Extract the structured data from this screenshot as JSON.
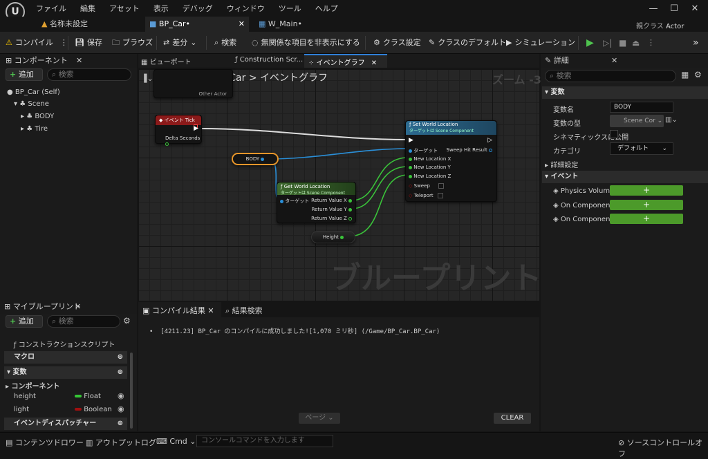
{
  "menu": [
    "ファイル",
    "編集",
    "アセット",
    "表示",
    "デバッグ",
    "ウィンドウ",
    "ツール",
    "ヘルプ"
  ],
  "tabs": {
    "untitled": "名称未設定",
    "bp_car": "BP_Car•",
    "w_main": "W_Main•"
  },
  "parent_class": {
    "label": "親クラス",
    "value": "Actor"
  },
  "toolbar": {
    "compile": "コンパイル",
    "save": "保存",
    "browse": "ブラウズ",
    "diff": "差分",
    "find": "検索",
    "hide_unrelated": "無関係な項目を非表示にする",
    "class_settings": "クラス設定",
    "class_defaults": "クラスのデフォルト",
    "simulation": "シミュレーション"
  },
  "components_panel": {
    "title": "コンポーネント",
    "add": "追加",
    "search_placeholder": "検索",
    "tree": [
      "BP_Car (Self)",
      "Scene",
      "BODY",
      "Tire"
    ]
  },
  "editor_tabs": {
    "viewport": "ビューポート",
    "construction": "Construction Scr...",
    "event_graph": "イベントグラフ"
  },
  "graph": {
    "breadcrumb_bp": "BP_Car",
    "breadcrumb_sep": ">",
    "breadcrumb_graph": "イベントグラフ",
    "zoom": "ズーム -3",
    "watermark": "ブループリント",
    "partial_node_pin": "Other Actor",
    "event_tick": {
      "title": "イベント Tick",
      "pin": "Delta Seconds"
    },
    "body_var": "BODY",
    "set_loc": {
      "title": "Set World Location",
      "subtitle": "ターゲットは Scene Component",
      "target": "ターゲット",
      "result": "Sweep Hit Result",
      "x": "New Location X",
      "y": "New Location Y",
      "z": "New Location Z",
      "sweep": "Sweep",
      "teleport": "Teleport"
    },
    "get_loc": {
      "title": "Get World Location",
      "subtitle": "ターゲットは Scene Component",
      "target": "ターゲット",
      "rx": "Return Value X",
      "ry": "Return Value Y",
      "rz": "Return Value Z"
    },
    "height_var": "Height"
  },
  "details": {
    "title": "詳細",
    "search_placeholder": "検索",
    "sec_variable": "変数",
    "var_name_label": "変数名",
    "var_name_value": "BODY",
    "var_type_label": "変数の型",
    "var_type_value": "Scene Cor",
    "cinematic_label": "シネマティックスに公開",
    "category_label": "カテゴリ",
    "category_value": "デフォルト",
    "advanced": "詳細設定",
    "sec_event": "イベント",
    "events": [
      "Physics Volume",
      "On Component",
      "On Component"
    ],
    "add_symbol": "+"
  },
  "my_blueprint": {
    "title": "マイブループリント",
    "add": "追加",
    "search_placeholder": "検索",
    "construction": "コンストラクションスクリプト",
    "macros": "マクロ",
    "variables": "変数",
    "components": "コンポーネント",
    "vars": [
      {
        "name": "height",
        "type": "Float",
        "color": "#35c635"
      },
      {
        "name": "light",
        "type": "Boolean",
        "color": "#a01010"
      }
    ],
    "dispatchers": "イベントディスパッチャー"
  },
  "compile_panel": {
    "tab_results": "コンパイル結果",
    "tab_find": "結果検索",
    "log": "[4211.23] BP_Car のコンパイルに成功しました![1,070 ミリ秒] (/Game/BP_Car.BP_Car)",
    "page": "ページ",
    "clear": "CLEAR"
  },
  "statusbar": {
    "content_drawer": "コンテンツドロワー",
    "output_log": "アウトプットログ",
    "cmd": "Cmd",
    "console_placeholder": "コンソールコマンドを入力します",
    "source_control": "ソースコントロールオフ"
  }
}
